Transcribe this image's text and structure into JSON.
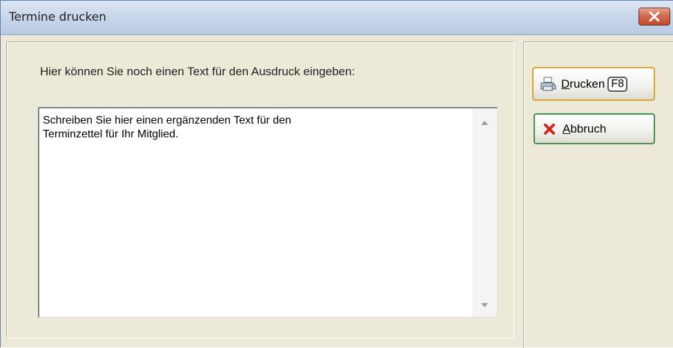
{
  "window": {
    "title": "Termine drucken"
  },
  "prompt": {
    "label": "Hier können Sie noch einen Text für den Ausdruck eingeben:"
  },
  "memo": {
    "lines": [
      "Schreiben Sie hier einen ergänzenden Text für den",
      "Terminzettel für Ihr Mitglied."
    ]
  },
  "buttons": {
    "print": {
      "mnemonic": "D",
      "label_rest": "rucken",
      "hotkey": "F8",
      "icon": "printer-icon"
    },
    "cancel": {
      "mnemonic": "A",
      "label_rest": "bbruch",
      "icon": "red-x-icon"
    }
  },
  "colors": {
    "print_border": "#d9a232",
    "cancel_border": "#3f8f4a",
    "close_red": "#c24a2c"
  }
}
